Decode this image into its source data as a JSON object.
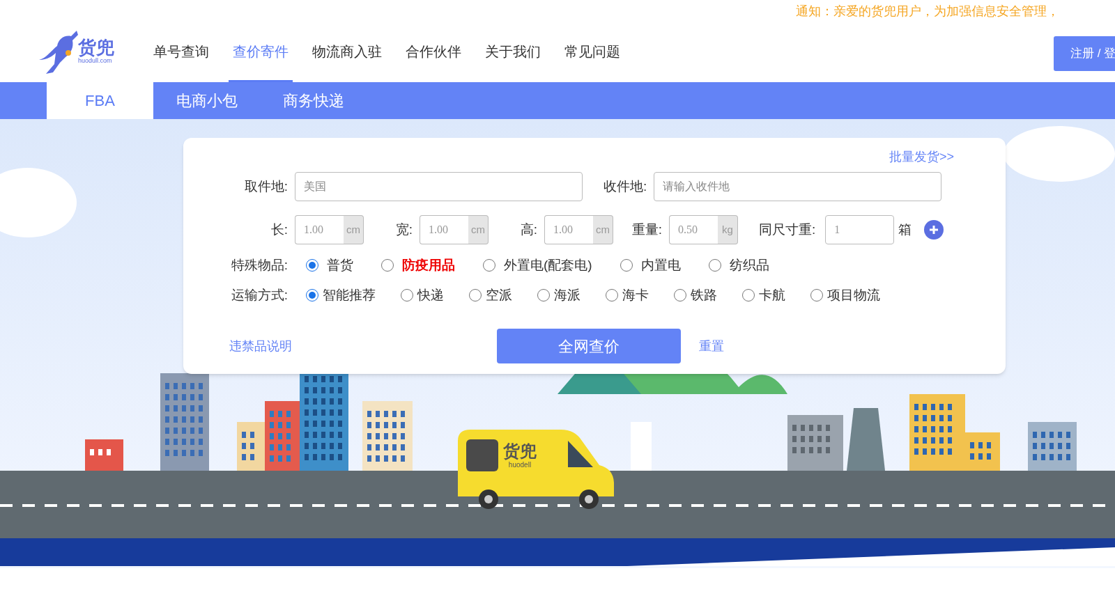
{
  "notice": "通知：亲爱的货兜用户，为加强信息安全管理，",
  "logo": {
    "name": "货兜",
    "domain": "huodull.com"
  },
  "nav": [
    {
      "label": "单号查询",
      "selected": false
    },
    {
      "label": "查价寄件",
      "selected": true
    },
    {
      "label": "物流商入驻",
      "selected": false
    },
    {
      "label": "合作伙伴",
      "selected": false
    },
    {
      "label": "关于我们",
      "selected": false
    },
    {
      "label": "常见问题",
      "selected": false
    }
  ],
  "auth_button": "注册 / 登",
  "tabs": [
    {
      "label": "FBA",
      "selected": true
    },
    {
      "label": "电商小包",
      "selected": false
    },
    {
      "label": "商务快递",
      "selected": false
    }
  ],
  "form": {
    "bulk_link": "批量发货>>",
    "origin": {
      "label": "取件地:",
      "placeholder": "美国"
    },
    "destination": {
      "label": "收件地:",
      "placeholder": "请输入收件地"
    },
    "dims": [
      {
        "label": "长:",
        "placeholder": "1.00",
        "unit": "cm"
      },
      {
        "label": "宽:",
        "placeholder": "1.00",
        "unit": "cm"
      },
      {
        "label": "高:",
        "placeholder": "1.00",
        "unit": "cm"
      },
      {
        "label": "重量:",
        "placeholder": "0.50",
        "unit": "kg"
      }
    ],
    "count": {
      "label": "同尺寸重:",
      "placeholder": "1",
      "unit": "箱"
    },
    "goods": {
      "label": "特殊物品:",
      "options": [
        {
          "label": "普货",
          "selected": true,
          "highlight": false
        },
        {
          "label": "防疫用品",
          "selected": false,
          "highlight": true
        },
        {
          "label": "外置电(配套电)",
          "selected": false,
          "highlight": false
        },
        {
          "label": "内置电",
          "selected": false,
          "highlight": false
        },
        {
          "label": "纺织品",
          "selected": false,
          "highlight": false
        }
      ]
    },
    "transport": {
      "label": "运输方式:",
      "options": [
        {
          "label": "智能推荐",
          "selected": true
        },
        {
          "label": "快递",
          "selected": false
        },
        {
          "label": "空派",
          "selected": false
        },
        {
          "label": "海派",
          "selected": false
        },
        {
          "label": "海卡",
          "selected": false
        },
        {
          "label": "铁路",
          "selected": false
        },
        {
          "label": "卡航",
          "selected": false
        },
        {
          "label": "项目物流",
          "selected": false
        }
      ]
    },
    "prohibited_link": "违禁品说明",
    "submit": "全网查价",
    "reset": "重置"
  },
  "truck_logo": {
    "name": "货兜",
    "domain": "huodell"
  }
}
